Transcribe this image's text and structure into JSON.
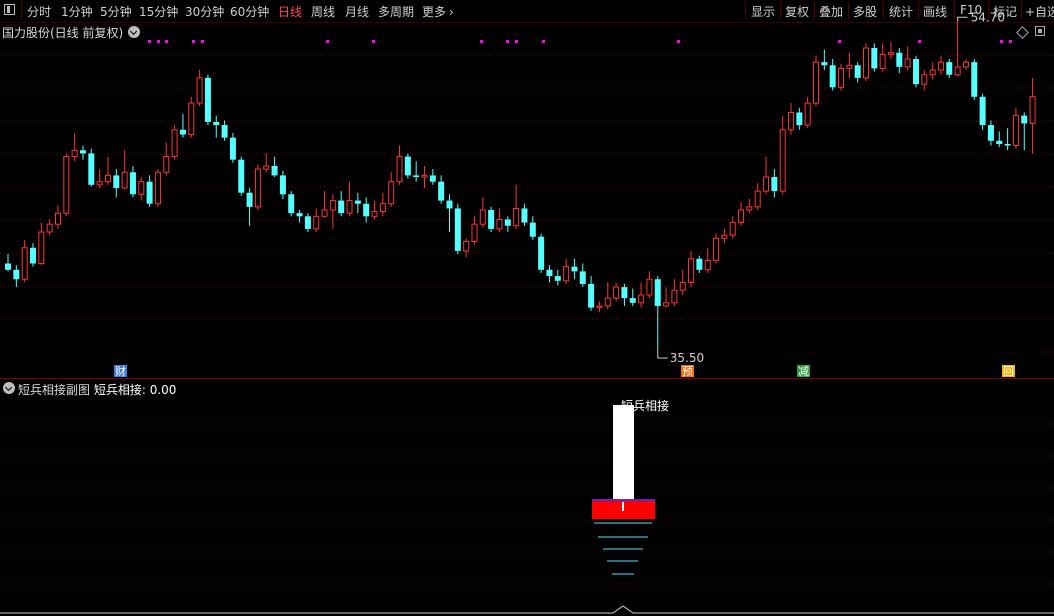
{
  "toolbar": {
    "periods": [
      "分时",
      "1分钟",
      "5分钟",
      "15分钟",
      "30分钟",
      "60分钟",
      "日线",
      "周线",
      "月线",
      "多周期"
    ],
    "active_period": "日线",
    "more_label": "更多",
    "more_icon": "chevron-right-icon",
    "right_buttons": [
      "显示",
      "复权",
      "叠加",
      "多股",
      "统计",
      "画线",
      "F10",
      "标记",
      "+自选"
    ]
  },
  "main_chart": {
    "title": "国力股份(日线 前复权)",
    "high_label": "54.70",
    "low_label": "35.50",
    "event_markers": [
      {
        "text": "财",
        "color": "#3a7bd5"
      },
      {
        "text": "预",
        "color": "#ff6a00"
      },
      {
        "text": "减",
        "color": "#2e9e3e"
      },
      {
        "text": "回",
        "color": "#ffb000"
      }
    ]
  },
  "sub_chart": {
    "title": "短兵相接副图",
    "indicator_name": "短兵相接",
    "indicator_value": ": 0.00",
    "signal_label": "短兵相接"
  },
  "colors": {
    "up": "#ff3333",
    "down": "#54ffff",
    "grid": "#7a0000",
    "marker_magenta": "#ff00ff",
    "signal_white": "#ffffff",
    "signal_red": "#ff0000",
    "signal_cyan": "#4fe3ff"
  },
  "chart_data": {
    "type": "candlestick",
    "title": "国力股份(日线 前复权)",
    "annotated_high": 54.7,
    "annotated_low": 35.5,
    "ohlc": [
      [
        41.0,
        40.6,
        41.6,
        40.5
      ],
      [
        40.6,
        40.0,
        40.9,
        39.5
      ],
      [
        40.0,
        42.0,
        42.5,
        39.8
      ],
      [
        42.0,
        41.0,
        42.3,
        40.8
      ],
      [
        41.0,
        43.0,
        43.6,
        40.9
      ],
      [
        43.0,
        43.5,
        43.8,
        42.8
      ],
      [
        43.5,
        44.2,
        44.7,
        43.2
      ],
      [
        44.2,
        47.8,
        48.0,
        44.0
      ],
      [
        47.8,
        48.2,
        49.3,
        47.5
      ],
      [
        48.2,
        48.0,
        48.5,
        47.6
      ],
      [
        48.0,
        46.0,
        48.3,
        45.9
      ],
      [
        46.0,
        46.2,
        47.0,
        45.8
      ],
      [
        46.2,
        46.6,
        47.8,
        46.0
      ],
      [
        46.6,
        45.8,
        47.0,
        45.2
      ],
      [
        45.8,
        46.8,
        48.2,
        45.7
      ],
      [
        46.8,
        45.4,
        47.2,
        45.2
      ],
      [
        45.4,
        46.2,
        46.5,
        45.0
      ],
      [
        46.2,
        44.8,
        46.6,
        44.6
      ],
      [
        44.8,
        46.8,
        47.0,
        44.6
      ],
      [
        46.8,
        47.8,
        48.7,
        46.6
      ],
      [
        47.8,
        49.5,
        49.8,
        47.6
      ],
      [
        49.5,
        49.2,
        50.5,
        49.0
      ],
      [
        49.2,
        51.2,
        51.6,
        49.0
      ],
      [
        51.2,
        52.8,
        53.3,
        51.0
      ],
      [
        52.8,
        50.0,
        53.0,
        49.8
      ],
      [
        50.0,
        49.8,
        50.4,
        49.0
      ],
      [
        49.8,
        49.0,
        50.1,
        48.8
      ],
      [
        49.0,
        47.6,
        49.3,
        47.4
      ],
      [
        47.6,
        45.5,
        47.8,
        45.3
      ],
      [
        45.5,
        44.6,
        45.8,
        43.4
      ],
      [
        44.6,
        47.0,
        47.3,
        44.4
      ],
      [
        47.0,
        47.2,
        48.0,
        46.8
      ],
      [
        47.2,
        46.6,
        47.8,
        46.5
      ],
      [
        46.6,
        45.4,
        46.9,
        45.1
      ],
      [
        45.4,
        44.2,
        45.6,
        44.0
      ],
      [
        44.2,
        44.0,
        44.4,
        43.6
      ],
      [
        44.0,
        43.2,
        44.2,
        43.0
      ],
      [
        43.2,
        44.0,
        44.5,
        43.0
      ],
      [
        44.0,
        44.4,
        45.6,
        43.9
      ],
      [
        44.4,
        45.0,
        45.4,
        43.2
      ],
      [
        45.0,
        44.2,
        45.6,
        44.0
      ],
      [
        44.2,
        45.0,
        46.2,
        44.0
      ],
      [
        45.0,
        44.8,
        45.5,
        44.2
      ],
      [
        44.8,
        44.0,
        45.2,
        43.6
      ],
      [
        44.0,
        44.3,
        45.0,
        43.8
      ],
      [
        44.3,
        44.8,
        45.5,
        44.0
      ],
      [
        44.8,
        46.2,
        46.8,
        44.6
      ],
      [
        46.2,
        47.8,
        48.5,
        46.0
      ],
      [
        47.8,
        46.6,
        48.0,
        46.4
      ],
      [
        46.6,
        46.5,
        47.5,
        46.2
      ],
      [
        46.5,
        46.6,
        47.2,
        45.8
      ],
      [
        46.6,
        46.2,
        47.0,
        46.0
      ],
      [
        46.2,
        45.0,
        46.6,
        44.8
      ],
      [
        45.0,
        44.5,
        45.4,
        43.0
      ],
      [
        44.5,
        41.8,
        44.8,
        41.6
      ],
      [
        41.8,
        42.4,
        42.6,
        41.4
      ],
      [
        42.4,
        43.5,
        44.0,
        42.2
      ],
      [
        43.5,
        44.4,
        45.2,
        43.3
      ],
      [
        44.4,
        43.2,
        44.6,
        43.0
      ],
      [
        43.2,
        43.8,
        44.5,
        43.0
      ],
      [
        43.8,
        43.4,
        44.0,
        43.0
      ],
      [
        43.4,
        44.5,
        46.0,
        43.2
      ],
      [
        44.5,
        43.6,
        44.8,
        43.4
      ],
      [
        43.6,
        42.7,
        44.0,
        42.5
      ],
      [
        42.7,
        40.6,
        42.9,
        40.4
      ],
      [
        40.6,
        40.2,
        40.9,
        39.8
      ],
      [
        40.2,
        39.9,
        40.6,
        39.6
      ],
      [
        39.9,
        40.8,
        41.3,
        39.7
      ],
      [
        40.8,
        40.5,
        41.3,
        40.0
      ],
      [
        40.5,
        39.7,
        41.0,
        39.5
      ],
      [
        39.7,
        38.2,
        40.2,
        38.0
      ],
      [
        38.2,
        38.3,
        38.6,
        37.9
      ],
      [
        38.3,
        38.8,
        39.8,
        38.1
      ],
      [
        38.8,
        39.5,
        39.8,
        38.6
      ],
      [
        39.5,
        38.8,
        39.7,
        38.3
      ],
      [
        38.8,
        38.5,
        39.4,
        38.3
      ],
      [
        38.5,
        39.0,
        39.8,
        38.2
      ],
      [
        39.0,
        40.0,
        40.5,
        38.8
      ],
      [
        40.0,
        38.3,
        40.2,
        35.5
      ],
      [
        38.3,
        38.5,
        39.5,
        38.2
      ],
      [
        38.5,
        39.3,
        40.0,
        38.3
      ],
      [
        39.3,
        39.8,
        40.6,
        39.0
      ],
      [
        39.8,
        41.3,
        41.8,
        39.5
      ],
      [
        41.3,
        40.6,
        41.5,
        40.4
      ],
      [
        40.6,
        41.2,
        42.0,
        40.4
      ],
      [
        41.2,
        42.6,
        42.9,
        41.0
      ],
      [
        42.6,
        42.8,
        43.2,
        42.3
      ],
      [
        42.8,
        43.6,
        44.0,
        42.6
      ],
      [
        43.6,
        44.4,
        44.9,
        43.4
      ],
      [
        44.4,
        44.6,
        45.1,
        44.2
      ],
      [
        44.6,
        45.6,
        46.1,
        44.4
      ],
      [
        45.6,
        46.5,
        47.8,
        45.4
      ],
      [
        46.5,
        45.6,
        47.0,
        45.2
      ],
      [
        45.6,
        49.5,
        50.4,
        45.4
      ],
      [
        49.5,
        50.6,
        51.2,
        49.2
      ],
      [
        50.6,
        49.8,
        50.9,
        49.5
      ],
      [
        49.8,
        51.2,
        51.6,
        49.6
      ],
      [
        51.2,
        53.8,
        54.2,
        51.0
      ],
      [
        53.8,
        53.6,
        54.6,
        53.3
      ],
      [
        53.6,
        52.2,
        54.0,
        52.0
      ],
      [
        52.2,
        53.4,
        53.7,
        52.0
      ],
      [
        53.4,
        53.6,
        54.4,
        52.8
      ],
      [
        53.6,
        52.8,
        53.8,
        52.5
      ],
      [
        52.8,
        54.7,
        55.0,
        52.6
      ],
      [
        54.7,
        53.4,
        55.0,
        53.2
      ],
      [
        53.4,
        54.3,
        55.0,
        53.2
      ],
      [
        54.3,
        54.4,
        55.1,
        54.0
      ],
      [
        54.4,
        53.5,
        54.7,
        53.1
      ],
      [
        53.5,
        54.0,
        54.8,
        53.3
      ],
      [
        54.0,
        52.4,
        54.2,
        52.2
      ],
      [
        52.4,
        53.0,
        53.3,
        52.0
      ],
      [
        53.0,
        53.3,
        53.8,
        52.7
      ],
      [
        53.3,
        53.8,
        54.2,
        53.0
      ],
      [
        53.8,
        53.0,
        54.0,
        52.8
      ],
      [
        53.0,
        53.5,
        56.4,
        52.9
      ],
      [
        53.5,
        53.8,
        54.0,
        53.3
      ],
      [
        53.8,
        51.6,
        54.0,
        51.4
      ],
      [
        51.6,
        49.8,
        51.8,
        49.5
      ],
      [
        49.8,
        48.8,
        50.1,
        48.5
      ],
      [
        48.8,
        48.6,
        49.4,
        48.4
      ],
      [
        48.6,
        48.5,
        49.6,
        48.2
      ],
      [
        48.5,
        50.4,
        50.9,
        48.3
      ],
      [
        50.4,
        49.9,
        50.6,
        48.2
      ],
      [
        49.9,
        51.6,
        52.8,
        48.0
      ]
    ]
  }
}
